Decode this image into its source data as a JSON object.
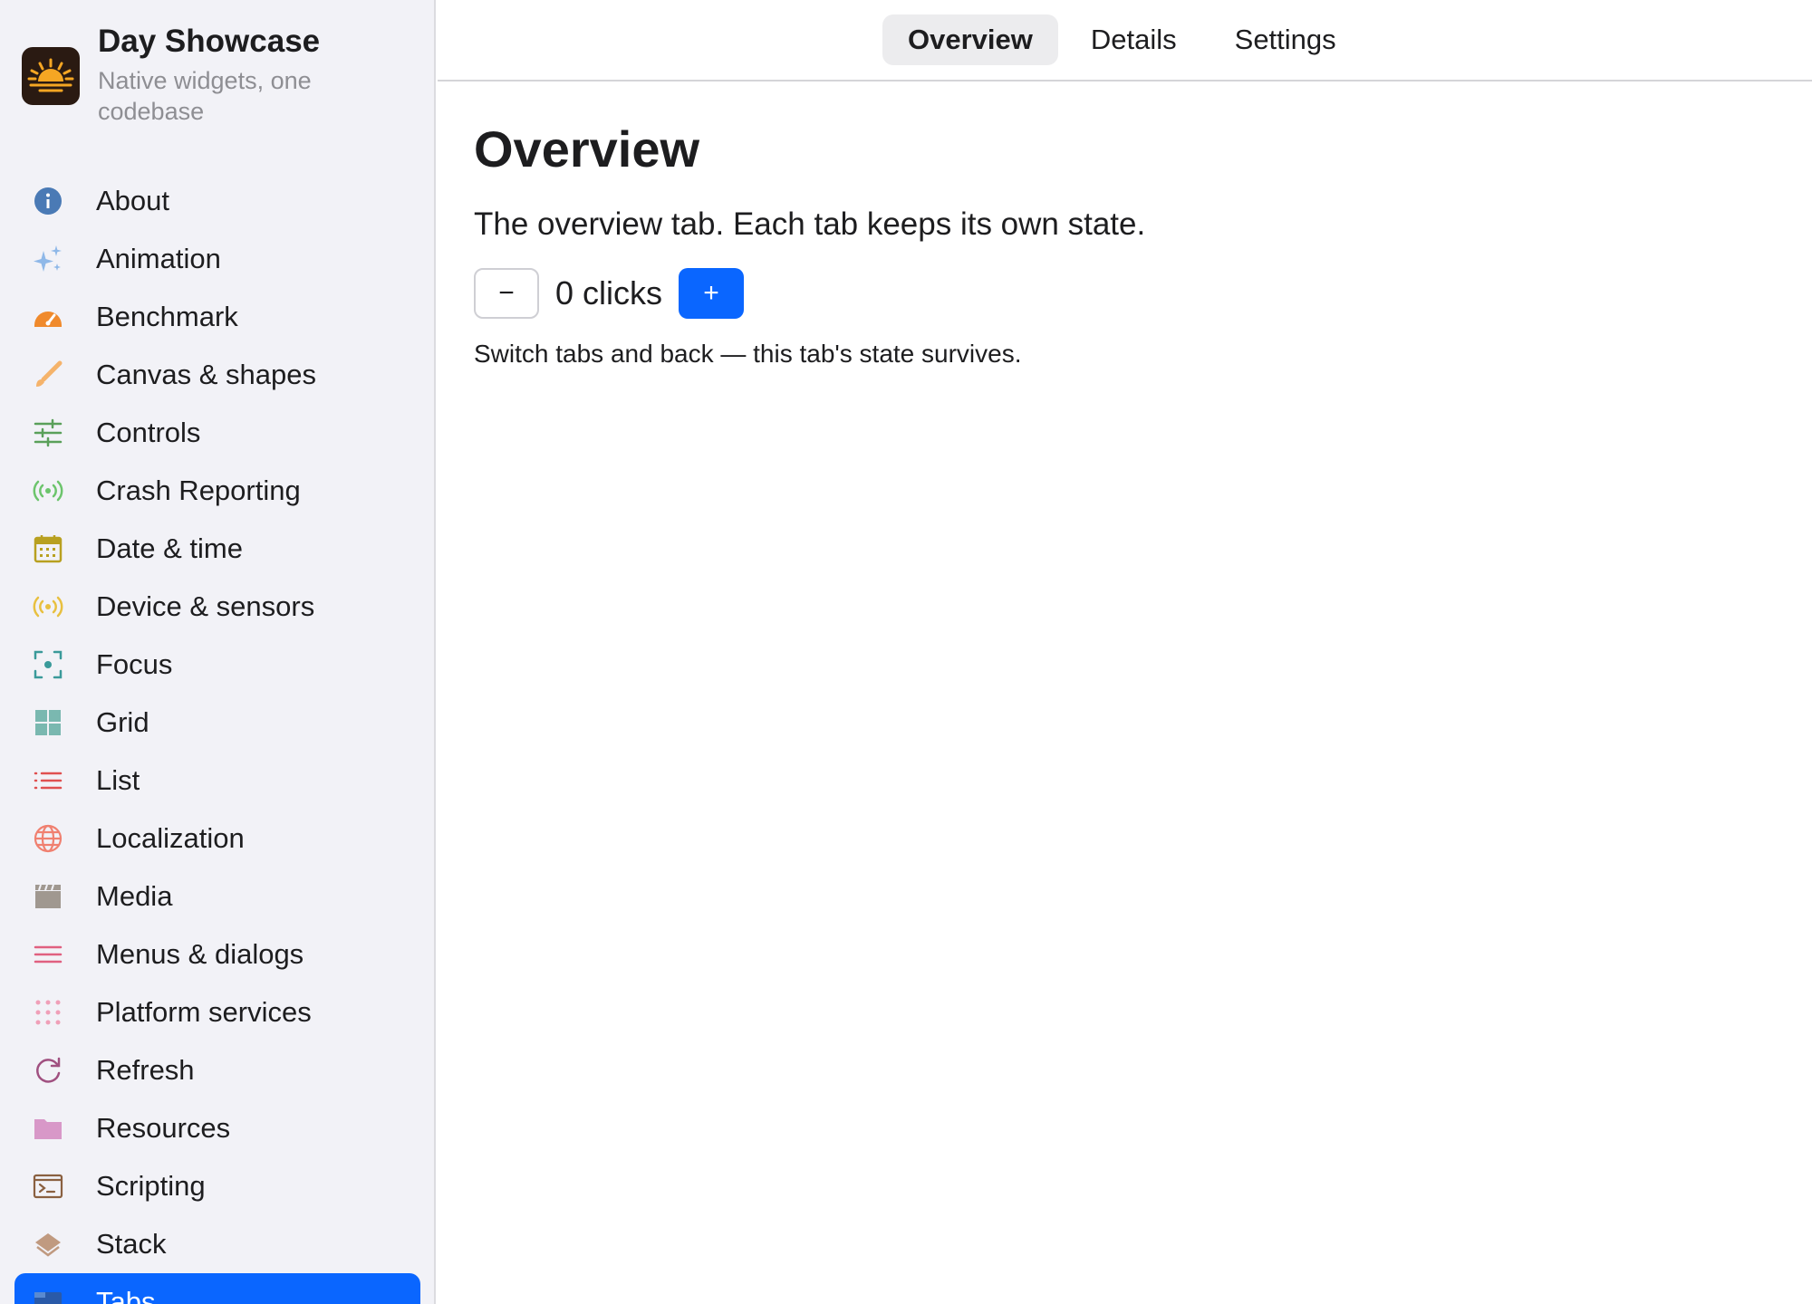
{
  "app": {
    "title": "Day Showcase",
    "subtitle": "Native widgets, one codebase"
  },
  "sidebar": {
    "items": [
      {
        "label": "About",
        "icon": "info-icon",
        "color": "#4a7ab5"
      },
      {
        "label": "Animation",
        "icon": "sparkles-icon",
        "color": "#8fb8e8"
      },
      {
        "label": "Benchmark",
        "icon": "gauge-icon",
        "color": "#f08a2c"
      },
      {
        "label": "Canvas & shapes",
        "icon": "paintbrush-icon",
        "color": "#f5b36b"
      },
      {
        "label": "Controls",
        "icon": "sliders-icon",
        "color": "#5aa05a"
      },
      {
        "label": "Crash Reporting",
        "icon": "broadcast-icon",
        "color": "#6cc46c"
      },
      {
        "label": "Date & time",
        "icon": "calendar-icon",
        "color": "#b8a020"
      },
      {
        "label": "Device & sensors",
        "icon": "sensor-icon",
        "color": "#e8c040"
      },
      {
        "label": "Focus",
        "icon": "focus-icon",
        "color": "#3a9a9a"
      },
      {
        "label": "Grid",
        "icon": "grid-icon",
        "color": "#7ab8b0"
      },
      {
        "label": "List",
        "icon": "list-icon",
        "color": "#e05050"
      },
      {
        "label": "Localization",
        "icon": "globe-icon",
        "color": "#f08070"
      },
      {
        "label": "Media",
        "icon": "clapperboard-icon",
        "color": "#a09890"
      },
      {
        "label": "Menus & dialogs",
        "icon": "menu-icon",
        "color": "#e06080"
      },
      {
        "label": "Platform services",
        "icon": "dots-grid-icon",
        "color": "#f0a0b8"
      },
      {
        "label": "Refresh",
        "icon": "refresh-icon",
        "color": "#a05080"
      },
      {
        "label": "Resources",
        "icon": "folder-icon",
        "color": "#d898c8"
      },
      {
        "label": "Scripting",
        "icon": "terminal-icon",
        "color": "#8a6040"
      },
      {
        "label": "Stack",
        "icon": "layers-icon",
        "color": "#c09a80"
      },
      {
        "label": "Tabs",
        "icon": "tabs-icon",
        "color": "#ffffff"
      }
    ],
    "active_index": 19
  },
  "tabs": [
    {
      "label": "Overview",
      "active": true
    },
    {
      "label": "Details",
      "active": false
    },
    {
      "label": "Settings",
      "active": false
    }
  ],
  "main": {
    "title": "Overview",
    "description": "The overview tab. Each tab keeps its own state.",
    "minus_label": "−",
    "plus_label": "+",
    "count_text": "0 clicks",
    "hint": "Switch tabs and back — this tab's state survives."
  },
  "colors": {
    "accent": "#0a66ff",
    "sidebar_bg": "#f2f2f7"
  }
}
